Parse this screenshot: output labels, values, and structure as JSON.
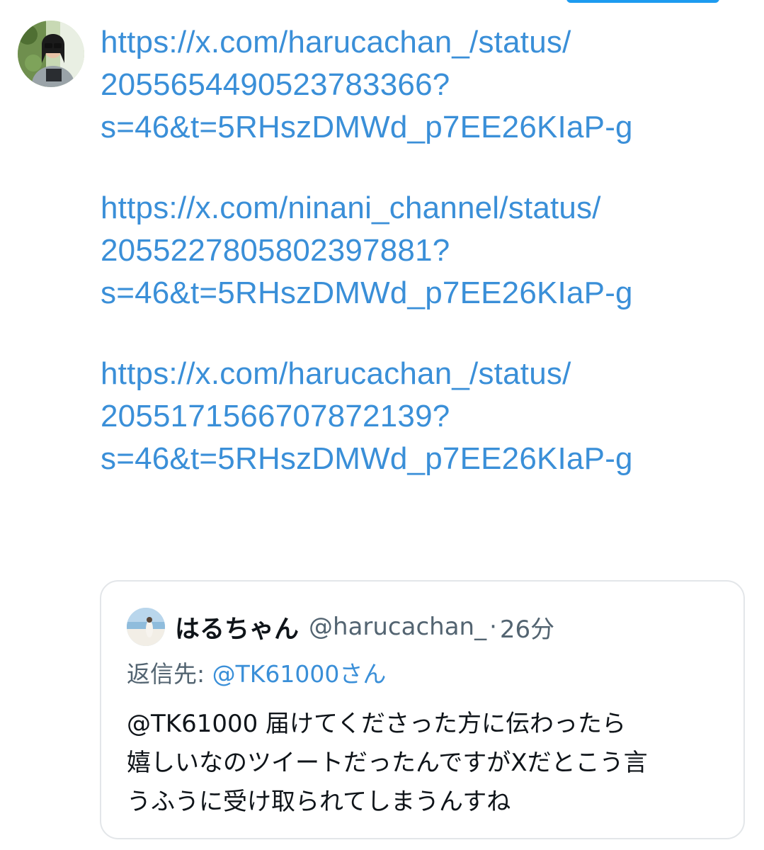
{
  "tweet": {
    "link_groups": [
      {
        "lines": [
          "https://x.com/harucachan_/status/",
          "2055654490523783366?",
          "s=46&t=5RHszDMWd_p7EE26KIaP-g"
        ]
      },
      {
        "lines": [
          "https://x.com/ninani_channel/status/",
          "2055227805802397881?",
          "s=46&t=5RHszDMWd_p7EE26KIaP-g"
        ]
      },
      {
        "lines": [
          "https://x.com/harucachan_/status/",
          "2055171566707872139?",
          "s=46&t=5RHszDMWd_p7EE26KIaP-g"
        ]
      }
    ]
  },
  "quote": {
    "display_name": "はるちゃん",
    "handle": "@harucachan_",
    "separator": "·",
    "time": "26分",
    "reply_label": "返信先: ",
    "reply_user": "@TK61000さん",
    "body_lines": [
      "@TK61000 届けてくださった方に伝わったら",
      "嬉しいなのツイートだったんですがXだとこう言",
      "うふうに受け取られてしまうんすね"
    ]
  },
  "colors": {
    "link": "#3a8fd8",
    "text": "#0f1419",
    "secondary": "#536471",
    "border": "#e3e6e9"
  },
  "icons": {
    "avatar": "profile-photo",
    "quote_avatar": "profile-photo-beach"
  }
}
